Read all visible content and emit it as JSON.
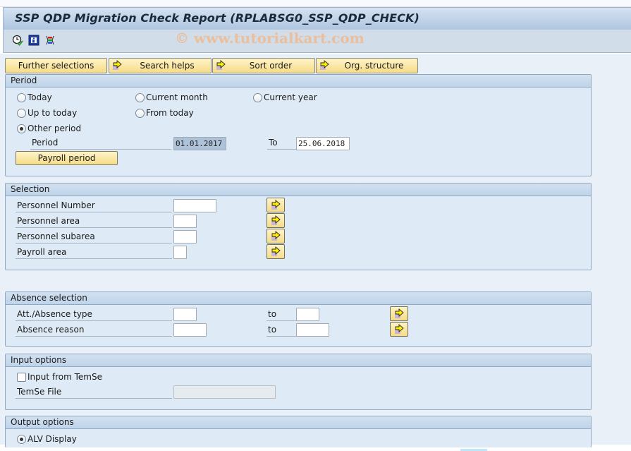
{
  "window": {
    "title": "SSP QDP Migration Check Report (RPLABSG0_SSP_QDP_CHECK)",
    "watermark": "© www.tutorialkart.com"
  },
  "toolbar": {
    "icons": [
      "execute-clock-icon",
      "info-icon",
      "selection-screen-icon"
    ]
  },
  "tabs": [
    {
      "label": "Further selections",
      "has_arrow": false
    },
    {
      "label": "Search helps",
      "has_arrow": true
    },
    {
      "label": "Sort order",
      "has_arrow": true
    },
    {
      "label": "Org. structure",
      "has_arrow": true
    }
  ],
  "period": {
    "title": "Period",
    "options": [
      {
        "label": "Today",
        "selected": false
      },
      {
        "label": "Current month",
        "selected": false
      },
      {
        "label": "Current year",
        "selected": false
      },
      {
        "label": "Up to today",
        "selected": false
      },
      {
        "label": "From today",
        "selected": false
      },
      {
        "label": "Other period",
        "selected": true
      }
    ],
    "period_label": "Period",
    "from_value": "01.01.2017",
    "to_label": "To",
    "to_value": "25.06.2018",
    "payroll_button": "Payroll period"
  },
  "selection": {
    "title": "Selection",
    "fields": [
      {
        "label": "Personnel Number",
        "value": ""
      },
      {
        "label": "Personnel area",
        "value": ""
      },
      {
        "label": "Personnel subarea",
        "value": ""
      },
      {
        "label": "Payroll area",
        "value": ""
      }
    ]
  },
  "absence": {
    "title": "Absence selection",
    "fields": [
      {
        "label": "Att./Absence type",
        "from": "",
        "to_label": "to",
        "to": ""
      },
      {
        "label": "Absence reason",
        "from": "",
        "to_label": "to",
        "to": ""
      }
    ]
  },
  "input_options": {
    "title": "Input options",
    "checkbox_label": "Input from TemSe",
    "checked": false,
    "file_label": "TemSe File",
    "file_value": ""
  },
  "output_options": {
    "title": "Output options",
    "alv_label": "ALV Display",
    "alv_selected": true
  }
}
